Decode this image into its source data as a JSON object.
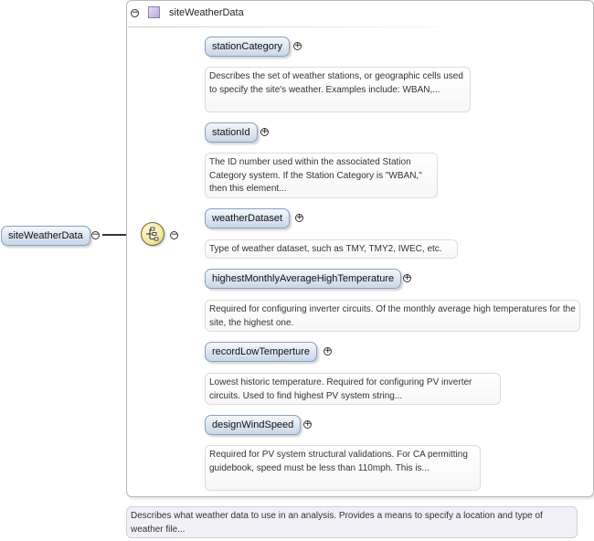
{
  "complex_type": {
    "title": "siteWeatherData"
  },
  "root_element": {
    "name": "siteWeatherData",
    "description": "Describes what weather data to use in an analysis. Provides a means to specify a location and type of weather file..."
  },
  "children": [
    {
      "name": "stationCategory",
      "description": "Describes the set of weather stations, or geographic cells used to specify the site's weather. Examples include: WBAN,..."
    },
    {
      "name": "stationId",
      "description": "The ID number used within the associated Station Category system. If the Station Category is \"WBAN,\" then this element..."
    },
    {
      "name": "weatherDataset",
      "description": "Type of weather dataset, such as TMY, TMY2, IWEC, etc."
    },
    {
      "name": "highestMonthlyAverageHighTemperature",
      "description": "Required for configuring inverter circuits. Of the monthly average high temperatures for the site, the highest one."
    },
    {
      "name": "recordLowTemperture",
      "description": "Lowest historic temperature. Required for configuring PV inverter circuits. Used to find highest PV system string..."
    },
    {
      "name": "designWindSpeed",
      "description": "Required for PV system structural validations. For CA permitting guidebook, speed must be less than 110mph. This is..."
    }
  ],
  "icons": {
    "expand": "plus-toggle-icon",
    "collapse": "minus-toggle-icon",
    "compositor": "sequence-compositor-icon",
    "type": "complex-type-icon"
  },
  "colors": {
    "pill_border": "#8aa0bd",
    "pill_fill": "#dfe8f3",
    "compositor_fill": "#f4e9a8",
    "type_icon": "#b9a9d8"
  }
}
